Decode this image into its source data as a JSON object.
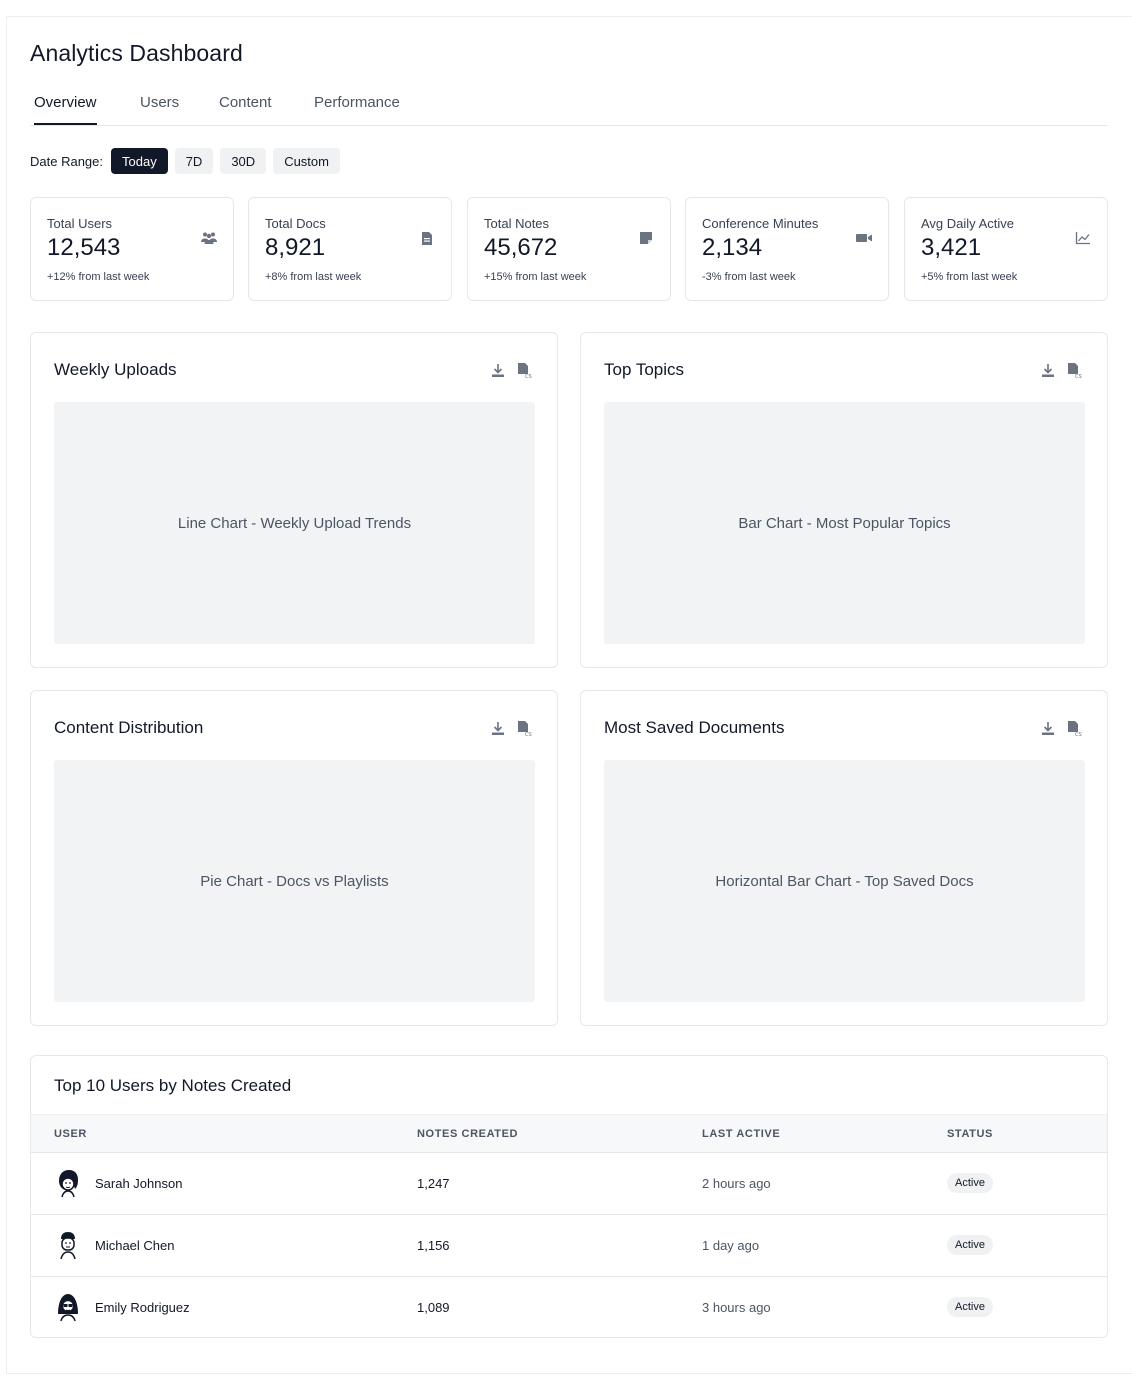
{
  "title": "Analytics Dashboard",
  "tabs": [
    {
      "label": "Overview",
      "active": true
    },
    {
      "label": "Users",
      "active": false
    },
    {
      "label": "Content",
      "active": false
    },
    {
      "label": "Performance",
      "active": false
    }
  ],
  "date_range": {
    "label": "Date Range:",
    "options": [
      "Today",
      "7D",
      "30D",
      "Custom"
    ],
    "selected": "Today"
  },
  "stats": [
    {
      "label": "Total Users",
      "value": "12,543",
      "change": "+12% from last week",
      "icon": "users-icon"
    },
    {
      "label": "Total Docs",
      "value": "8,921",
      "change": "+8% from last week",
      "icon": "document-icon"
    },
    {
      "label": "Total Notes",
      "value": "45,672",
      "change": "+15% from last week",
      "icon": "note-icon"
    },
    {
      "label": "Conference Minutes",
      "value": "2,134",
      "change": "-3% from last week",
      "icon": "video-icon"
    },
    {
      "label": "Avg Daily Active",
      "value": "3,421",
      "change": "+5% from last week",
      "icon": "line-chart-icon"
    }
  ],
  "cards": [
    {
      "title": "Weekly Uploads",
      "placeholder": "Line Chart - Weekly Upload Trends"
    },
    {
      "title": "Top Topics",
      "placeholder": "Bar Chart - Most Popular Topics"
    },
    {
      "title": "Content Distribution",
      "placeholder": "Pie Chart - Docs vs Playlists"
    },
    {
      "title": "Most Saved Documents",
      "placeholder": "Horizontal Bar Chart - Top Saved Docs"
    }
  ],
  "card_actions": {
    "download_icon": "download-icon",
    "csv_icon": "csv-file-icon"
  },
  "table": {
    "title": "Top 10 Users by Notes Created",
    "columns": [
      "USER",
      "NOTES CREATED",
      "LAST ACTIVE",
      "STATUS"
    ],
    "rows": [
      {
        "name": "Sarah Johnson",
        "notes": "1,247",
        "last_active": "2 hours ago",
        "status": "Active"
      },
      {
        "name": "Michael Chen",
        "notes": "1,156",
        "last_active": "1 day ago",
        "status": "Active"
      },
      {
        "name": "Emily Rodriguez",
        "notes": "1,089",
        "last_active": "3 hours ago",
        "status": "Active"
      }
    ]
  },
  "colors": {
    "accent": "#111827",
    "muted_text": "#4b5563",
    "chart_bg": "#f2f3f5",
    "border": "#e5e7eb"
  }
}
